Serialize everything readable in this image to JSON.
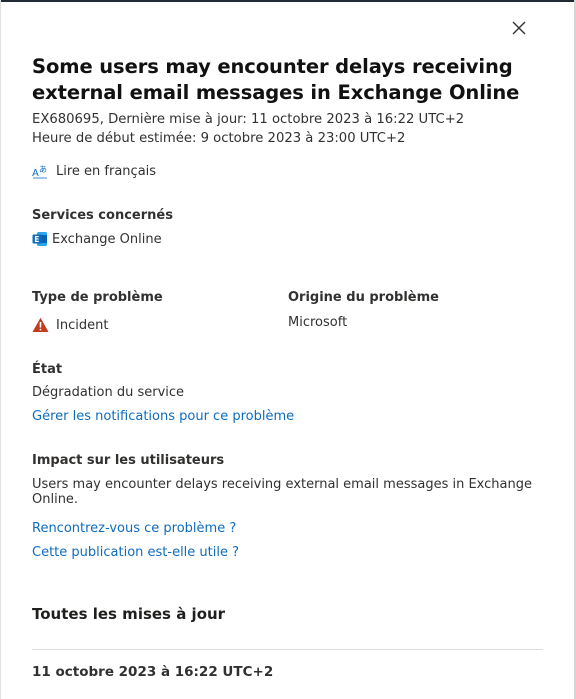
{
  "panel": {
    "close_icon": "close-icon",
    "title": "Some users may encounter delays receiving external email messages in Exchange Online",
    "meta_line1": "EX680695, Dernière mise à jour: 11 octobre 2023 à 16:22 UTC+2",
    "meta_line2": "Heure de début estimée: 9 octobre 2023 à 23:00 UTC+2",
    "translate_icon": "translate-icon",
    "translate_label": "Lire en français"
  },
  "services": {
    "label": "Services concernés",
    "icon": "exchange-icon",
    "value": "Exchange Online"
  },
  "issue_type": {
    "label": "Type de problème",
    "icon": "warning-icon",
    "icon_color": "#c23b1e",
    "value": "Incident"
  },
  "issue_origin": {
    "label": "Origine du problème",
    "value": "Microsoft"
  },
  "status": {
    "label": "État",
    "value": "Dégradation du service",
    "manage_link": "Gérer les notifications pour ce problème"
  },
  "user_impact": {
    "label": "Impact sur les utilisateurs",
    "value": "Users may encounter delays receiving external email messages in Exchange Online."
  },
  "feedback": {
    "experiencing_link": "Rencontrez-vous ce problème ?",
    "helpful_link": "Cette publication est-elle utile ?"
  },
  "updates": {
    "title": "Toutes les mises à jour",
    "first_date": "11 octobre 2023 à 16:22 UTC+2"
  },
  "colors": {
    "link": "#0f6cbd",
    "text": "#323130",
    "warning": "#c23b1e",
    "exchange": "#0f6cbd"
  }
}
